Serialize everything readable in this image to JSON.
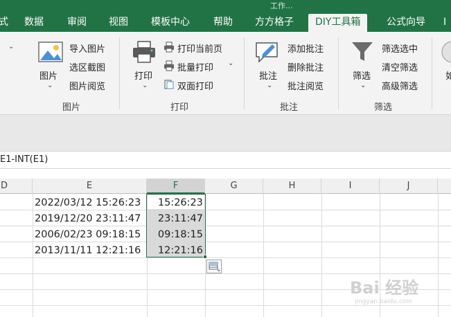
{
  "window": {
    "title_partial": "工作..."
  },
  "tabs": [
    {
      "label": "式"
    },
    {
      "label": "数据"
    },
    {
      "label": "审阅"
    },
    {
      "label": "视图"
    },
    {
      "label": "模板中心"
    },
    {
      "label": "帮助"
    },
    {
      "label": "方方格子"
    },
    {
      "label": "DIY工具箱"
    },
    {
      "label": "公式向导"
    },
    {
      "label": "I"
    }
  ],
  "ribbon": {
    "picture": {
      "big_label": "图片",
      "items": [
        "导入图片",
        "选区截图",
        "图片阅览"
      ],
      "group_label": "图片"
    },
    "print": {
      "big_label": "打印",
      "items": [
        "打印当前页",
        "批量打印",
        "双面打印"
      ],
      "group_label": "打印"
    },
    "comment": {
      "big_label": "批注",
      "items": [
        "添加批注",
        "删除批注",
        "批注阅览"
      ],
      "group_label": "批注"
    },
    "filter": {
      "big_label": "筛选",
      "items": [
        "筛选选中",
        "清空筛选",
        "高级筛选"
      ],
      "group_label": "筛选"
    },
    "partial_label": "如"
  },
  "formula_bar": {
    "text": "E1-INT(E1)"
  },
  "columns": [
    "D",
    "E",
    "F",
    "G",
    "H",
    "I",
    "J"
  ],
  "rows": [
    {
      "e": "2022/03/12 15:26:23",
      "f": "15:26:23"
    },
    {
      "e": "2019/12/20 23:11:47",
      "f": "23:11:47"
    },
    {
      "e": "2006/02/23 09:18:15",
      "f": "09:18:15"
    },
    {
      "e": "2013/11/11 12:21:16",
      "f": "12:21:16"
    }
  ],
  "watermark": {
    "main": "Bai 经验",
    "sub": "jingyan.baidu.com"
  },
  "colors": {
    "accent": "#217346",
    "ribbon_bg": "#f3f3f3",
    "selection": "#d9d9d9"
  }
}
